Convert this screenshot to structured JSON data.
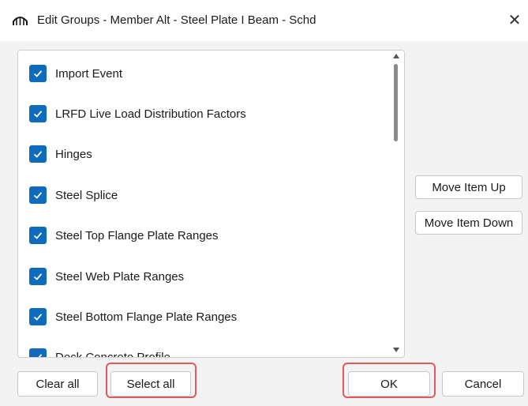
{
  "window": {
    "title": "Edit Groups - Member Alt - Steel Plate I Beam - Schd",
    "close_glyph": "✕"
  },
  "list": {
    "items": [
      {
        "label": "Import Event",
        "checked": true
      },
      {
        "label": "LRFD Live Load Distribution Factors",
        "checked": true
      },
      {
        "label": "Hinges",
        "checked": true
      },
      {
        "label": "Steel Splice",
        "checked": true
      },
      {
        "label": "Steel Top Flange Plate Ranges",
        "checked": true
      },
      {
        "label": "Steel Web Plate Ranges",
        "checked": true
      },
      {
        "label": "Steel Bottom Flange Plate Ranges",
        "checked": true
      },
      {
        "label": "Deck Concrete Profile",
        "checked": true
      }
    ]
  },
  "side_buttons": {
    "move_up": "Move Item Up",
    "move_down": "Move Item Down"
  },
  "footer": {
    "clear_all": "Clear all",
    "select_all": "Select all",
    "ok": "OK",
    "cancel": "Cancel"
  },
  "colors": {
    "checkbox": "#0f6cbd",
    "highlight": "#e05a5a"
  }
}
